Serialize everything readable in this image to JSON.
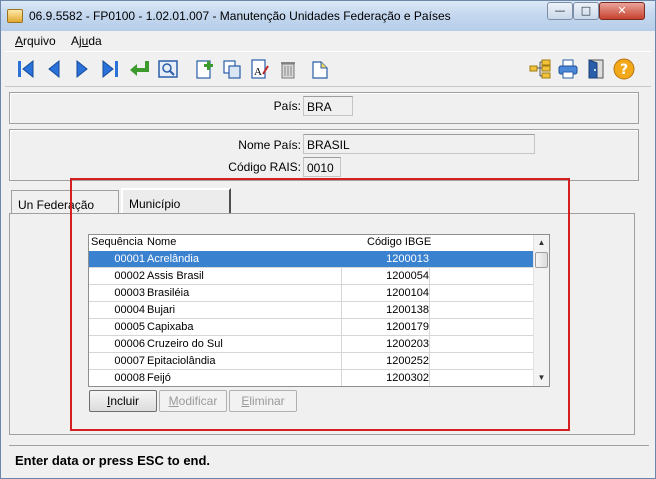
{
  "window": {
    "title": "06.9.5582 - FP0100 - 1.02.01.007 - Manutenção Unidades Federação e Países",
    "controls": {
      "minimize": "—",
      "maximize": "□",
      "close": "✕"
    }
  },
  "menu": {
    "items": [
      {
        "label": "Arquivo",
        "mnemonic": "A",
        "rest": "rquivo"
      },
      {
        "label": "Ajuda",
        "pre": "Aj",
        "mnemonic": "u",
        "rest": "da"
      }
    ]
  },
  "toolbar": {
    "buttons": [
      "first-record-icon",
      "previous-record-icon",
      "next-record-icon",
      "last-record-icon",
      "go-to-icon",
      "search-icon",
      "add-icon",
      "copy-icon",
      "edit-text-icon",
      "delete-icon",
      "new-document-icon",
      "tree-icon",
      "print-icon",
      "exit-door-icon",
      "help-icon"
    ],
    "help_glyph": "?"
  },
  "form": {
    "pais_label": "País:",
    "pais_value": "BRA",
    "nome_pais_label": "Nome País:",
    "nome_pais_value": "BRASIL",
    "codigo_rais_label": "Código RAIS:",
    "codigo_rais_value": "0010"
  },
  "tabs": [
    {
      "label": "Un Federação",
      "active": false
    },
    {
      "label": "Município",
      "active": true
    }
  ],
  "grid": {
    "columns": [
      "Sequência",
      "Nome",
      "Código IBGE"
    ],
    "rows": [
      {
        "seq": "00001",
        "nome": "Acrelândia",
        "ibge": "1200013",
        "selected": true
      },
      {
        "seq": "00002",
        "nome": "Assis Brasil",
        "ibge": "1200054",
        "selected": false
      },
      {
        "seq": "00003",
        "nome": "Brasiléia",
        "ibge": "1200104",
        "selected": false
      },
      {
        "seq": "00004",
        "nome": "Bujari",
        "ibge": "1200138",
        "selected": false
      },
      {
        "seq": "00005",
        "nome": "Capixaba",
        "ibge": "1200179",
        "selected": false
      },
      {
        "seq": "00006",
        "nome": "Cruzeiro do Sul",
        "ibge": "1200203",
        "selected": false
      },
      {
        "seq": "00007",
        "nome": "Epitaciolândia",
        "ibge": "1200252",
        "selected": false
      },
      {
        "seq": "00008",
        "nome": "Feijó",
        "ibge": "1200302",
        "selected": false
      }
    ],
    "scroll_up": "▲",
    "scroll_down": "▼"
  },
  "actions": {
    "incluir": {
      "pre": "",
      "mnemonic": "I",
      "rest": "ncluir",
      "enabled": true
    },
    "modificar": {
      "pre": "",
      "mnemonic": "M",
      "rest": "odificar",
      "enabled": false
    },
    "eliminar": {
      "pre": "",
      "mnemonic": "E",
      "rest": "liminar",
      "enabled": false
    }
  },
  "status": {
    "text": "Enter data or press ESC to end."
  },
  "colors": {
    "selection": "#3a82d0",
    "highlight_box": "#d42020",
    "toolbar_blue": "#2a72d8"
  }
}
